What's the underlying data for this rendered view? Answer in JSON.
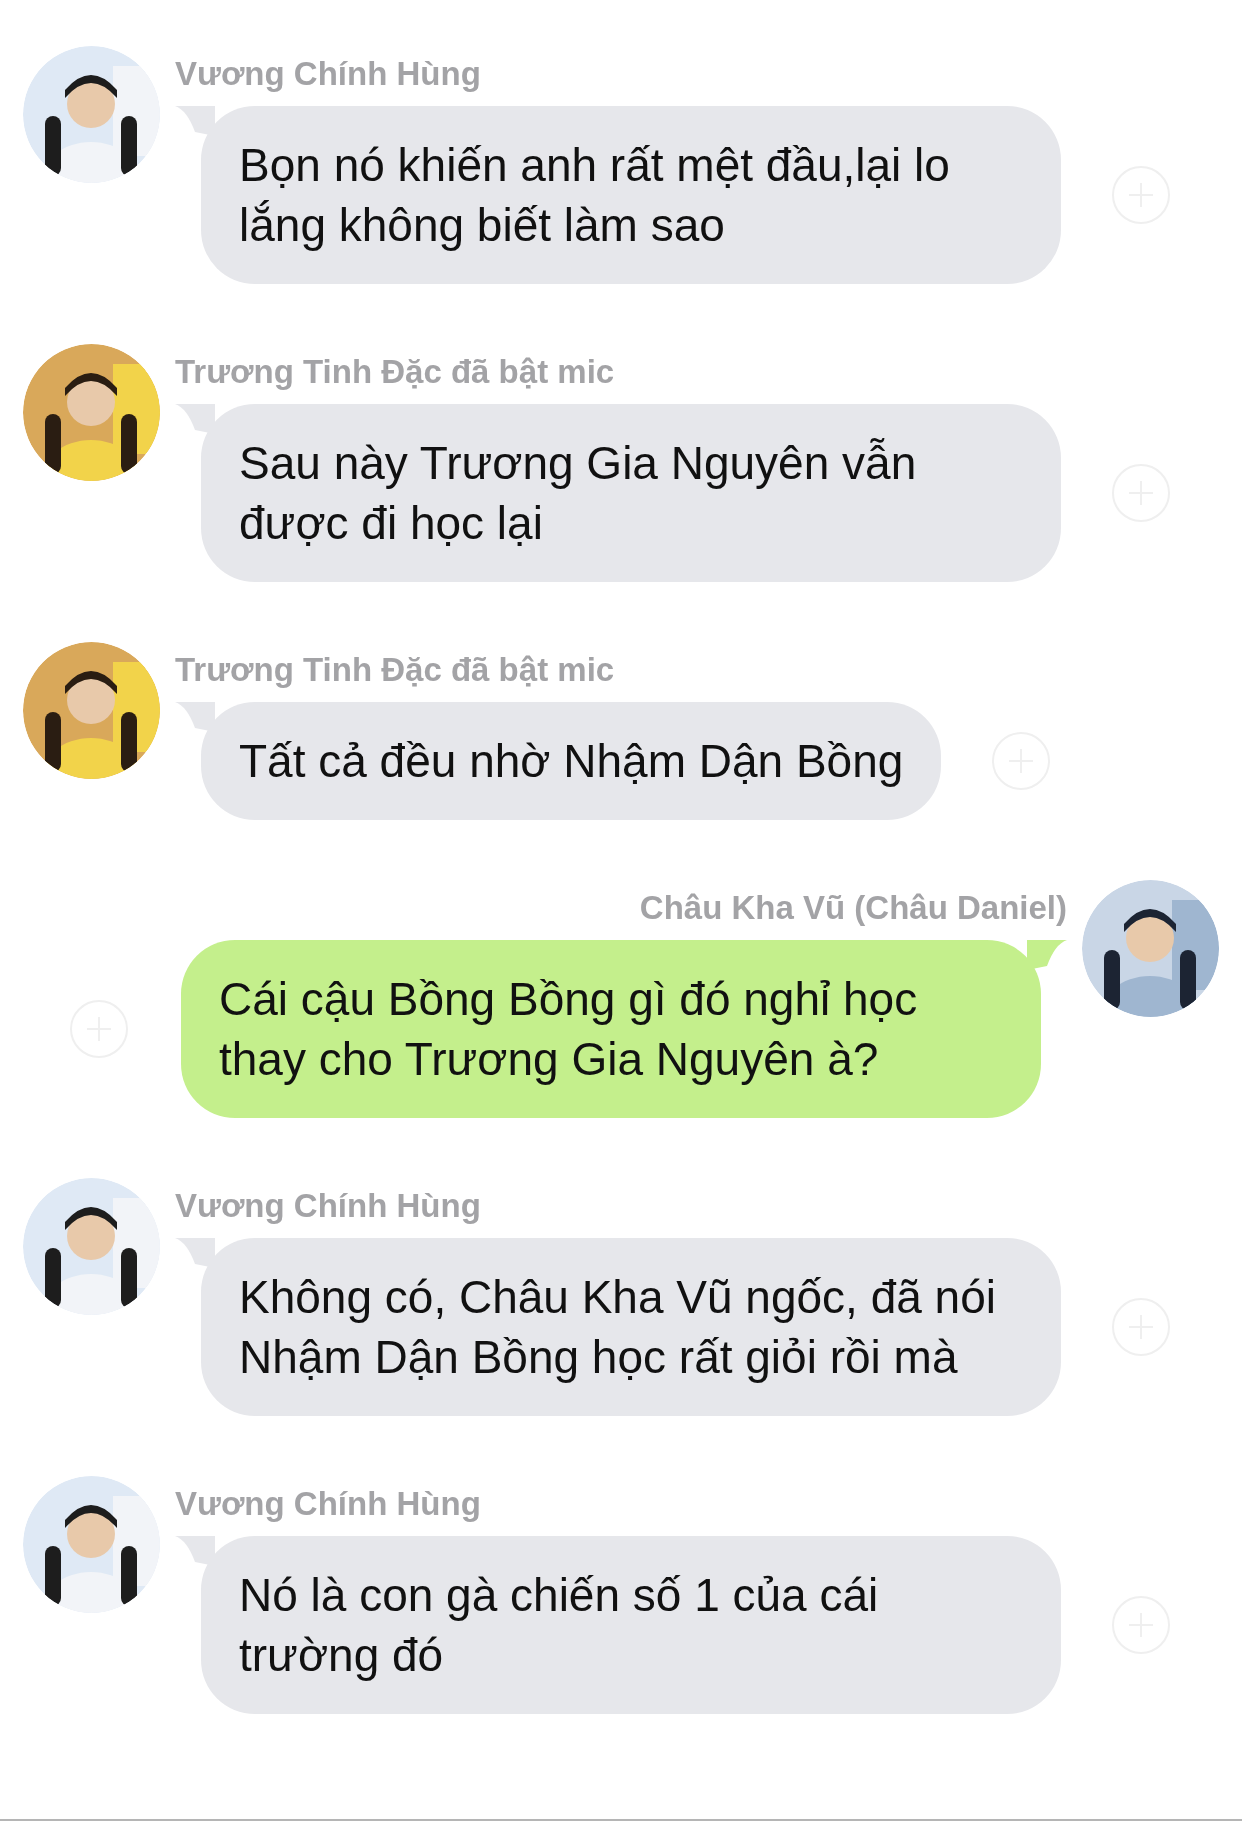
{
  "messages": [
    {
      "outgoing": false,
      "sender": "Vương Chính Hùng",
      "text": "Bọn nó khiến anh rất mệt đầu,lại lo lắng không biết làm sao"
    },
    {
      "outgoing": false,
      "sender": "Trương Tinh Đặc đã bật mic",
      "text": "Sau này Trương Gia Nguyên vẫn được đi học lại"
    },
    {
      "outgoing": false,
      "sender": "Trương Tinh Đặc đã bật mic",
      "text": "Tất cả đều nhờ Nhậm Dận Bồng"
    },
    {
      "outgoing": true,
      "sender": "Châu Kha Vũ (Châu Daniel)",
      "text": "Cái cậu Bồng Bồng gì đó nghỉ học thay cho Trương Gia Nguyên à?"
    },
    {
      "outgoing": false,
      "sender": "Vương Chính Hùng",
      "text": "Không có, Châu Kha Vũ ngốc, đã nói Nhậm Dận Bồng học rất giỏi rồi mà"
    },
    {
      "outgoing": false,
      "sender": "Vương Chính Hùng",
      "text": "Nó là con gà chiến số 1 của cái trường đó"
    }
  ]
}
